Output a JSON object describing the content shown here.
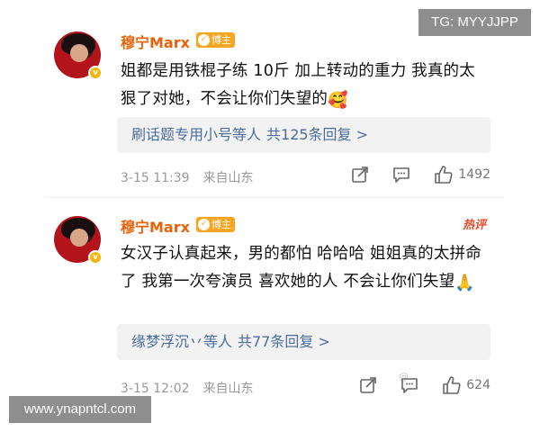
{
  "watermarks": {
    "top_right": "TG: MYYJJPP",
    "bottom_left": "www.ynapntcl.com",
    "faint": "@…"
  },
  "comments": [
    {
      "author": "穆宁Marx",
      "tag_label": "博主",
      "hot_label": "",
      "text": "姐都是用铁棍子练 10斤  加上转动的重力  我真的太狠了对她，不会让你们失望的",
      "emoji": "🥰",
      "reply_user": "刷话题专用小号等人",
      "reply_summary": "共125条回复 >",
      "date": "3-15 11:39",
      "location": "来自山东",
      "like_count": "1492"
    },
    {
      "author": "穆宁Marx",
      "tag_label": "博主",
      "hot_label": "热评",
      "text": "女汉子认真起来，男的都怕  哈哈哈  姐姐真的太拼命了  我第一次夸演员  喜欢她的人 不会让你们失望",
      "emoji": "🙏",
      "reply_user": "缘梦浮沉丷等人",
      "reply_summary": "共77条回复 >",
      "date": "3-15 12:02",
      "location": "来自山东",
      "like_count": "624"
    }
  ],
  "icons": {
    "avatar_badge": "v-badge-icon",
    "tag": "blogger-tag-icon",
    "share": "share-icon",
    "comment": "comment-icon",
    "like": "thumbs-up-icon"
  },
  "colors": {
    "author": "#e8630a",
    "tag_bg": "#f6a623",
    "hot": "#e84a2a",
    "reply_link": "#4a6c9c",
    "meta": "#999999"
  }
}
